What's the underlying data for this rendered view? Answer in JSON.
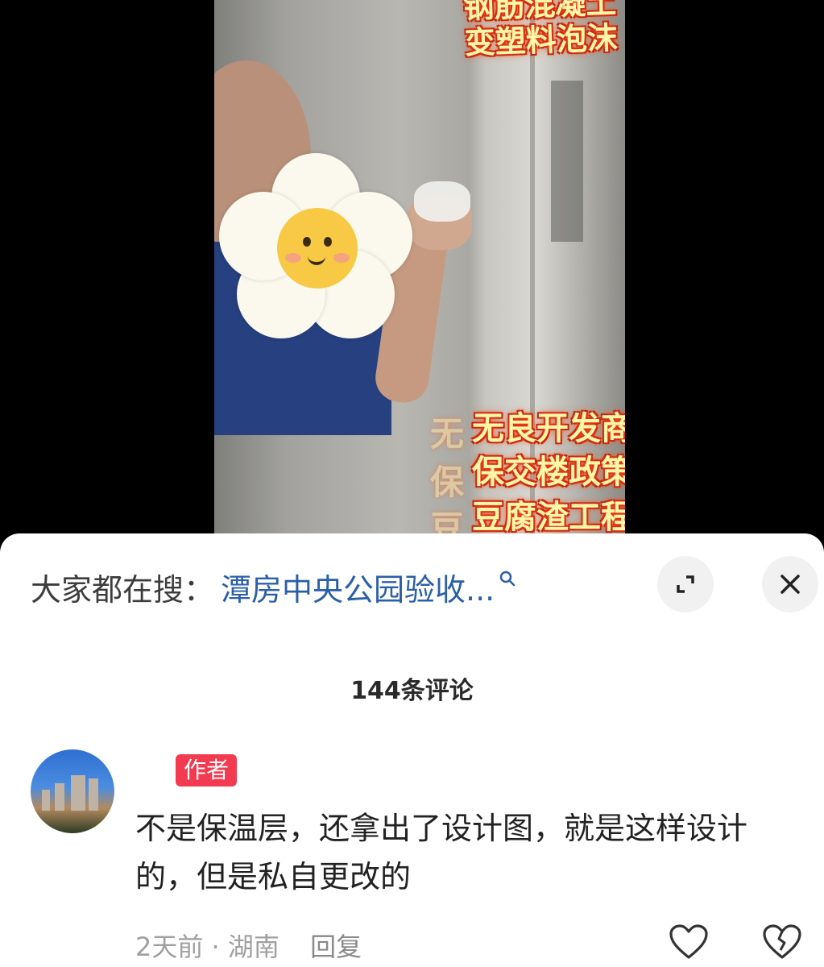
{
  "video": {
    "caption_top": "钢筋混凝土\n变塑料泡沫",
    "caption_lines": [
      "无良开发商吃相难看",
      "保交楼政策变",
      "豆腐渣工程"
    ],
    "ghost_lines": [
      "无",
      "保",
      "豆"
    ]
  },
  "search": {
    "label": "大家都在搜：",
    "query": "潭房中央公园验收...",
    "icon": "search-icon"
  },
  "controls": {
    "expand_icon": "expand-icon",
    "close_icon": "close-icon"
  },
  "comments": {
    "count_label": "144条评论",
    "items": [
      {
        "badge": "作者",
        "text": "不是保温层，还拿出了设计图，就是这样设计的，但是私自更改的",
        "time_location": "2天前 · 湖南",
        "reply_label": "回复",
        "like_icon": "heart-icon",
        "dislike_icon": "broken-heart-icon"
      }
    ]
  },
  "colors": {
    "link": "#2b5fa7",
    "badge": "#f23a50",
    "caption": "#fff7a8",
    "caption_glow": "#ff5a1a"
  }
}
